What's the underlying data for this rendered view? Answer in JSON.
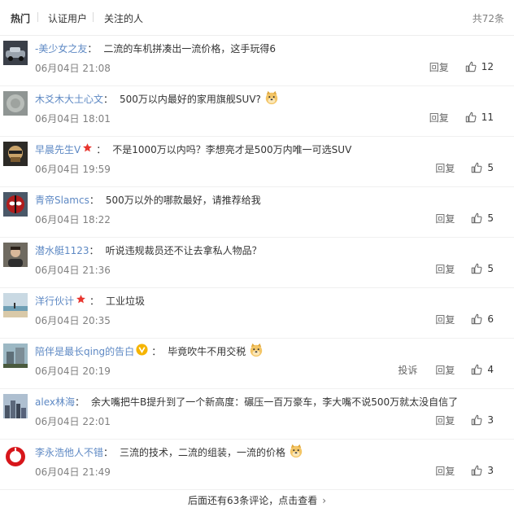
{
  "tabs": [
    {
      "label": "热门"
    },
    {
      "label": "认证用户"
    },
    {
      "label": "关注的人"
    }
  ],
  "total": "共72条",
  "actions": {
    "reply": "回复",
    "report": "投诉"
  },
  "comments": [
    {
      "user": "-美少女之友",
      "colon": "：",
      "text": "二流的车机拼凑出一流价格，这手玩得6",
      "time": "06月04日 21:08",
      "likes": "12",
      "avatar": "car-icon",
      "badge": "",
      "emoji": ""
    },
    {
      "user": "木爻木大土心文",
      "colon": "：",
      "text": "500万以内最好的家用旗舰SUV?",
      "time": "06月04日 18:01",
      "likes": "11",
      "avatar": "gray-disc",
      "badge": "",
      "emoji": "doge-emoji"
    },
    {
      "user": "早晨先生V",
      "colon": "：",
      "text": "不是1000万以内吗？李想亮才是500万内唯一可选SUV",
      "time": "06月04日 19:59",
      "likes": "5",
      "avatar": "face-icon",
      "badge": "red-star",
      "emoji": ""
    },
    {
      "user": "青帝Slamcs",
      "colon": "：",
      "text": "500万以外的哪款最好，请推荐给我",
      "time": "06月04日 18:22",
      "likes": "5",
      "avatar": "deadpool-icon",
      "badge": "",
      "emoji": ""
    },
    {
      "user": "潜水艇1123",
      "colon": "：",
      "text": "听说违规裁员还不让去拿私人物品？",
      "time": "06月04日 21:36",
      "likes": "5",
      "avatar": "person-icon",
      "badge": "",
      "emoji": ""
    },
    {
      "user": "洋行伙计",
      "colon": "：",
      "text": "工业垃圾",
      "time": "06月04日 20:35",
      "likes": "6",
      "avatar": "beach-icon",
      "badge": "red-star",
      "emoji": ""
    },
    {
      "user": "陪伴是最长qing的告白",
      "colon": "：",
      "text": "毕竟吹牛不用交税",
      "time": "06月04日 20:19",
      "likes": "4",
      "avatar": "building-icon",
      "badge": "yellow-v",
      "emoji": "doge-emoji",
      "report": true
    },
    {
      "user": "alex林海",
      "colon": "：",
      "text": "余大嘴把牛B提升到了一个新高度：碾压一百万豪车，李大嘴不说500万就太没自信了",
      "time": "06月04日 22:01",
      "likes": "3",
      "avatar": "city-icon",
      "badge": "",
      "emoji": ""
    },
    {
      "user": "李永浩他人不错",
      "colon": "：",
      "text": "三流的技术，二流的组装，一流的价格",
      "time": "06月04日 21:49",
      "likes": "3",
      "avatar": "red-logo-icon",
      "badge": "",
      "emoji": "doge-emoji"
    }
  ],
  "footer": {
    "more": "后面还有63条评论，点击查看",
    "chevron": "›"
  },
  "colors": {
    "link": "#5e89c4",
    "muted": "#808080",
    "star": "#e8362f",
    "v_badge": "#f5b400"
  }
}
